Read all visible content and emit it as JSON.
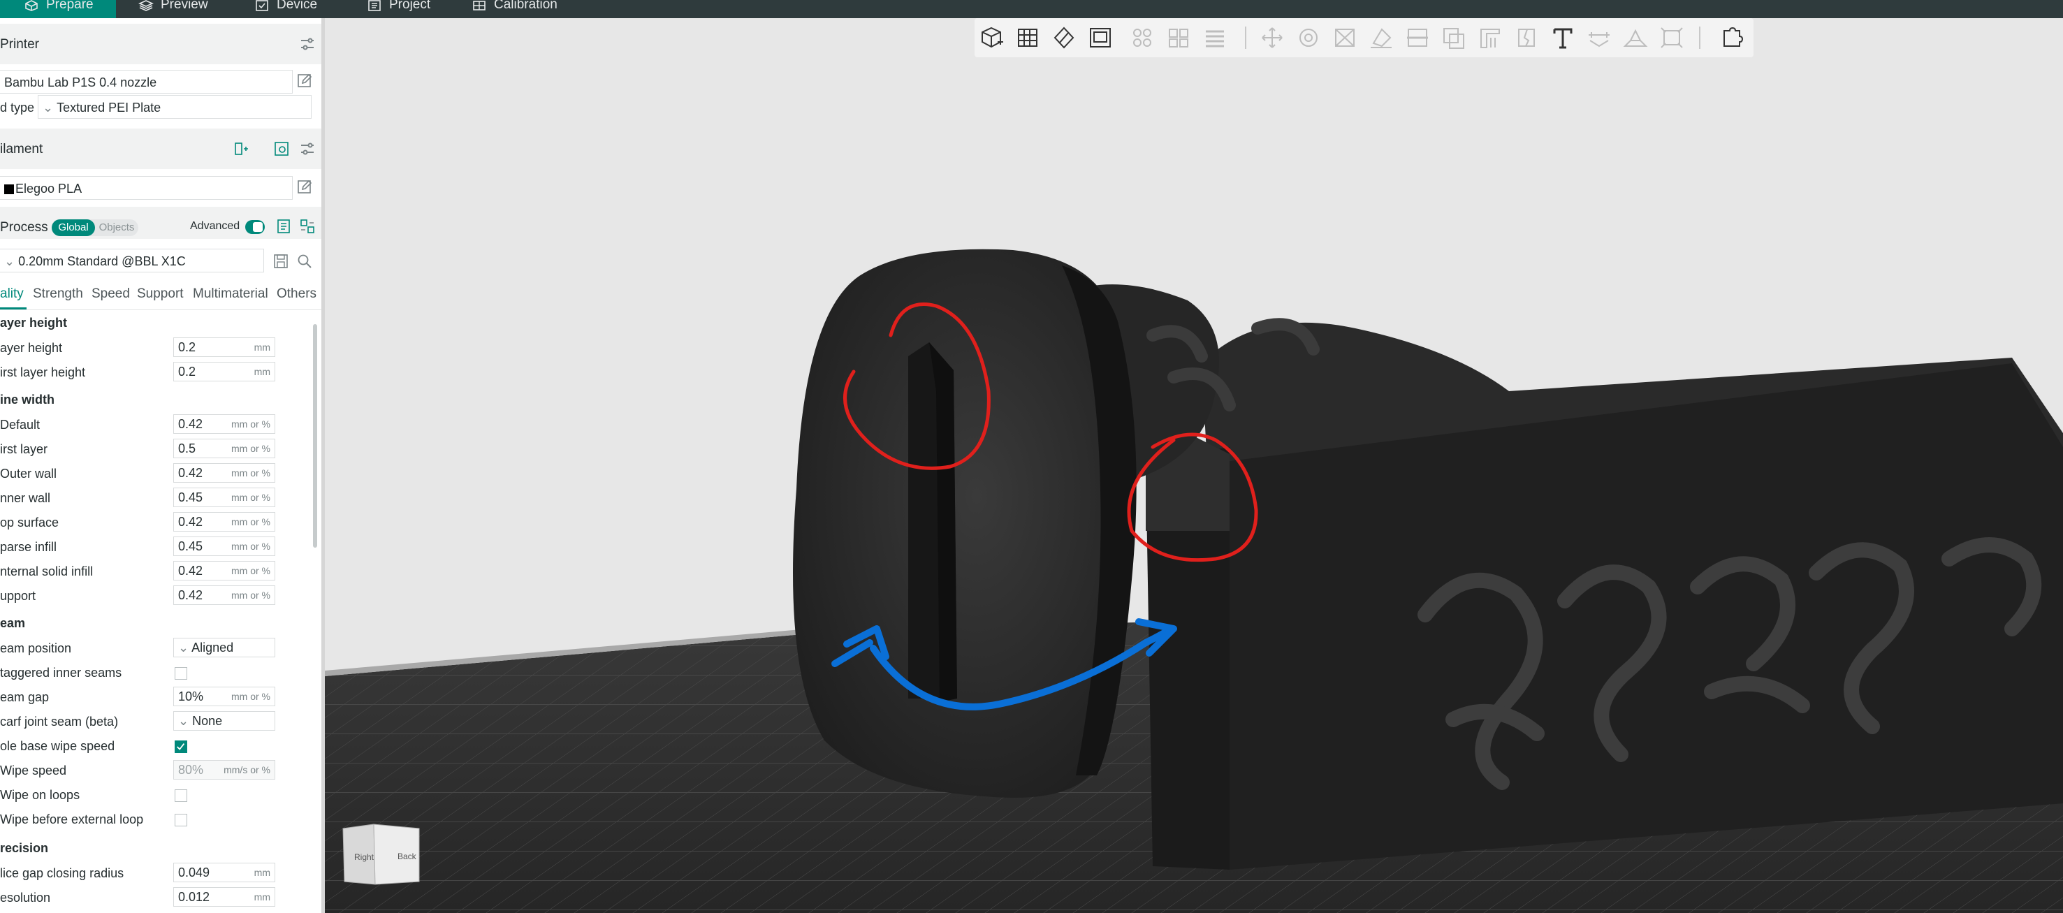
{
  "tabs": [
    {
      "label": "Prepare",
      "icon": "cube-icon",
      "active": true
    },
    {
      "label": "Preview",
      "icon": "layers-icon",
      "active": false
    },
    {
      "label": "Device",
      "icon": "device-icon",
      "active": false
    },
    {
      "label": "Project",
      "icon": "project-icon",
      "active": false
    },
    {
      "label": "Calibration",
      "icon": "calibration-icon",
      "active": false
    }
  ],
  "printer": {
    "title": "Printer",
    "name": "Bambu Lab P1S 0.4 nozzle",
    "bed_label": "d type",
    "bed_value": "Textured PEI Plate"
  },
  "filament": {
    "title": "ilament",
    "name": "Elegoo PLA",
    "swatch_color": "#000000"
  },
  "process": {
    "title": "Process",
    "global_label": "Global",
    "objects_label": "Objects",
    "advanced_label": "Advanced",
    "advanced_on": true,
    "preset": "0.20mm Standard @BBL X1C"
  },
  "settings_tabs": [
    "ality",
    "Strength",
    "Speed",
    "Support",
    "Multimaterial",
    "Others"
  ],
  "groups": {
    "layer_height": "ayer height",
    "line_width": "ine width",
    "seam": "eam",
    "precision": "recision"
  },
  "rows": {
    "layer_height": {
      "label": "ayer height",
      "value": "0.2",
      "unit": "mm"
    },
    "first_layer_height": {
      "label": "irst layer height",
      "value": "0.2",
      "unit": "mm"
    },
    "default": {
      "label": "Default",
      "value": "0.42",
      "unit": "mm or %"
    },
    "first_layer": {
      "label": "irst layer",
      "value": "0.5",
      "unit": "mm or %"
    },
    "outer_wall": {
      "label": "Outer wall",
      "value": "0.42",
      "unit": "mm or %"
    },
    "inner_wall": {
      "label": "nner wall",
      "value": "0.45",
      "unit": "mm or %"
    },
    "top_surface": {
      "label": "op surface",
      "value": "0.42",
      "unit": "mm or %"
    },
    "sparse_infill": {
      "label": "parse infill",
      "value": "0.45",
      "unit": "mm or %"
    },
    "internal_solid_infill": {
      "label": "nternal solid infill",
      "value": "0.42",
      "unit": "mm or %"
    },
    "support": {
      "label": "upport",
      "value": "0.42",
      "unit": "mm or %"
    },
    "seam_position": {
      "label": "eam position",
      "value": "Aligned"
    },
    "staggered_inner_seams": {
      "label": "taggered inner seams",
      "checked": false
    },
    "seam_gap": {
      "label": "eam gap",
      "value": "10%",
      "unit": "mm or %"
    },
    "scarf_joint_seam": {
      "label": "carf joint seam (beta)",
      "value": "None"
    },
    "role_base_wipe_speed": {
      "label": "ole base wipe speed",
      "checked": true
    },
    "wipe_speed": {
      "label": "Wipe speed",
      "value": "80%",
      "unit": "mm/s or %"
    },
    "wipe_on_loops": {
      "label": "Wipe on loops",
      "checked": false
    },
    "wipe_before_external_loop": {
      "label": "Wipe before external loop",
      "checked": false
    },
    "slice_gap_closing_radius": {
      "label": "lice gap closing radius",
      "value": "0.049",
      "unit": "mm"
    },
    "resolution": {
      "label": "esolution",
      "value": "0.012",
      "unit": "mm"
    }
  },
  "view_cube": {
    "right": "Right",
    "back": "Back"
  },
  "annotation_colors": {
    "circle": "#e0201c",
    "arrow": "#0a6fd6"
  },
  "colors": {
    "accent": "#00897b",
    "topbar": "#2f3b3d",
    "model": "#2b2b2b"
  }
}
